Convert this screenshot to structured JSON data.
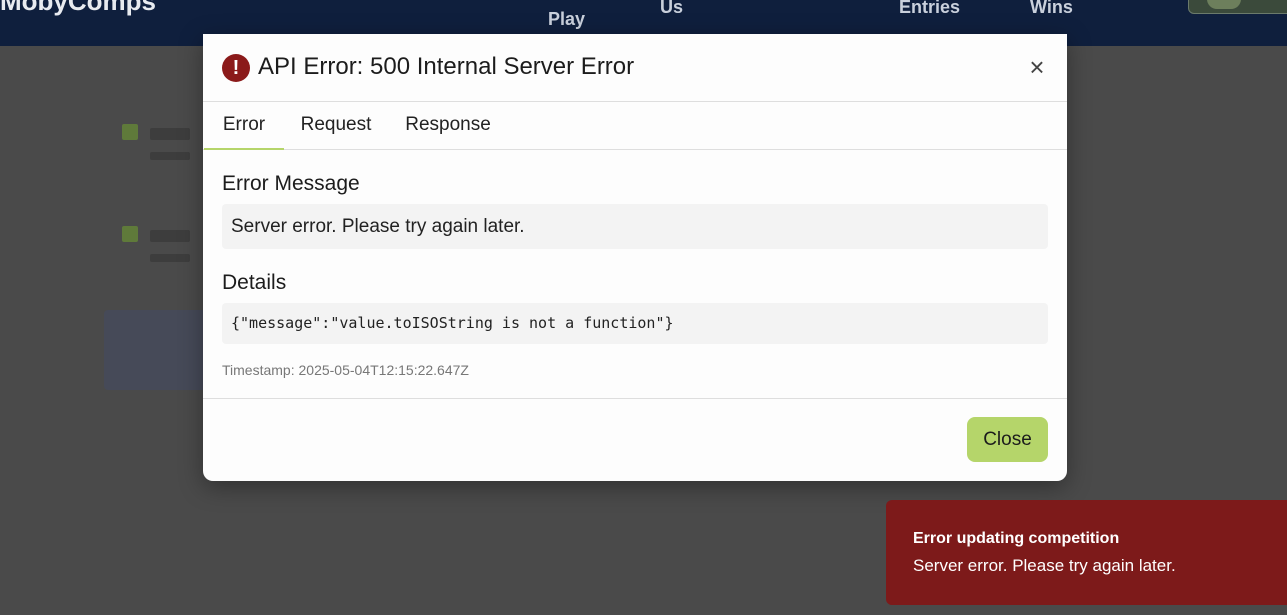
{
  "nav": {
    "brand": "MobyComps",
    "items": [
      "Play",
      "Us",
      "Entries",
      "Wins"
    ]
  },
  "modal": {
    "title": "API Error: 500 Internal Server Error",
    "close_glyph": "×",
    "tabs": [
      "Error",
      "Request",
      "Response"
    ],
    "active_tab": "Error",
    "error_message_label": "Error Message",
    "error_message": "Server error. Please try again later.",
    "details_label": "Details",
    "details": "{\"message\":\"value.toISOString is not a function\"}",
    "timestamp": "Timestamp: 2025-05-04T12:15:22.647Z",
    "close_button": "Close",
    "icon": "exclamation-circle-icon"
  },
  "toast": {
    "title": "Error updating competition",
    "message": "Server error. Please try again later."
  },
  "colors": {
    "accent": "#b5d56a",
    "error": "#8b1a1a",
    "toast_bg": "#7d1a1a",
    "nav_bg": "#0f1f3d"
  }
}
